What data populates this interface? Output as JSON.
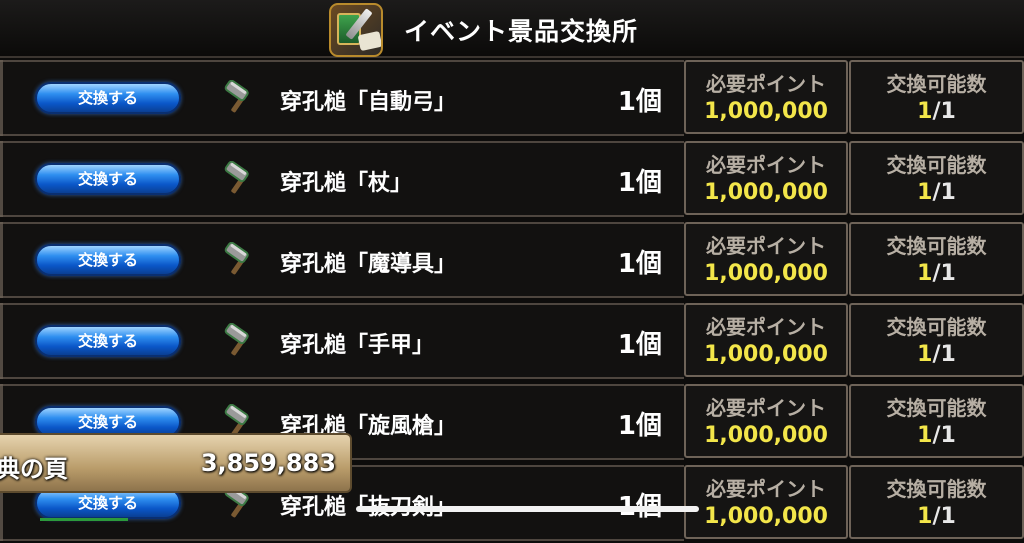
{
  "header": {
    "title": "イベント景品交換所",
    "icon": "event-shop-icon"
  },
  "labels": {
    "exchange_button": "交換する",
    "points_label": "必要ポイント",
    "count_label": "交換可能数"
  },
  "items": [
    {
      "name": "穿孔槌「自動弓」",
      "qty": "1個",
      "points": "1,000,000",
      "count_have": "1",
      "count_rest": "/1"
    },
    {
      "name": "穿孔槌「杖」",
      "qty": "1個",
      "points": "1,000,000",
      "count_have": "1",
      "count_rest": "/1"
    },
    {
      "name": "穿孔槌「魔導具」",
      "qty": "1個",
      "points": "1,000,000",
      "count_have": "1",
      "count_rest": "/1"
    },
    {
      "name": "穿孔槌「手甲」",
      "qty": "1個",
      "points": "1,000,000",
      "count_have": "1",
      "count_rest": "/1"
    },
    {
      "name": "穿孔槌「旋風槍」",
      "qty": "1個",
      "points": "1,000,000",
      "count_have": "1",
      "count_rest": "/1"
    },
    {
      "name": "穿孔槌「抜刀剣」",
      "qty": "1個",
      "points": "1,000,000",
      "count_have": "1",
      "count_rest": "/1"
    }
  ],
  "balance": {
    "label": "典の頁",
    "value": "3,859,883"
  },
  "colors": {
    "button_blue": "#1a6fe0",
    "points_yellow": "#f3e64a",
    "frame_brown": "#6e6358"
  }
}
